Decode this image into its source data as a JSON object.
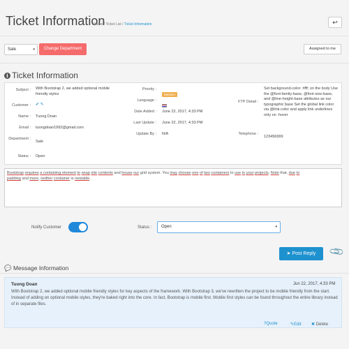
{
  "header": {
    "title": "Ticket Information",
    "breadcrumb": [
      "Home",
      "Ticket List",
      "Ticket Information"
    ],
    "back_icon": "↩"
  },
  "toolbar": {
    "department_value": "Sale",
    "change_department_label": "Change Department",
    "assigned_label": "Assigned to me"
  },
  "ticket": {
    "section_title": "Ticket Information",
    "subject_label": "Subject :",
    "subject_value": "With Bootstrap 2, we added optional mobile friendly styles",
    "customer_label": "Customer :",
    "name_label": "Name :",
    "name_value": "Tuong Doan",
    "email_label": "Email :",
    "email_value": "tuongdoan1992@gmail.com",
    "department_label": "Department :",
    "department_value": "Sale",
    "status_label": "Status :",
    "status_value": "Open",
    "priority_label": "Priority :",
    "priority_value": "Medium",
    "language_label": "Language :",
    "date_added_label": "Date Added :",
    "date_added_value": "June 22, 2017, 4:33 PM",
    "last_update_label": "Last Update :",
    "last_update_value": "June 22, 2017, 4:33 PM",
    "update_by_label": "Update By :",
    "update_by_value": "N/A",
    "ftp_label": "FTP Detail :",
    "ftp_value": "Set background-color: #fff; on the body Use the @font-family-base, @font-size-base, and @line-height-base attributes as our typographic base Set the global link color via @link-color and apply link underlines only on :hover",
    "telephone_label": "Telephone :",
    "telephone_value": "123456999"
  },
  "reply": {
    "text_parts": [
      "Bootstrap",
      " ",
      "requires",
      " ",
      "a containing element",
      " ",
      "to",
      " ",
      "wrap",
      " ",
      "site",
      " ",
      "contents",
      " and ",
      "house",
      " ",
      "our",
      " grid system. You ",
      "may",
      " ",
      "choose",
      " ",
      "one",
      " ",
      "of",
      " ",
      "two",
      " ",
      "containers",
      " to ",
      "use",
      " ",
      "in",
      " ",
      "your",
      " ",
      "projects",
      ". ",
      "Note",
      " that, ",
      "due",
      " ",
      "to",
      "\n",
      "padding",
      " and ",
      "more",
      ", ",
      "neither",
      " ",
      "container",
      " is ",
      "nestable",
      "."
    ],
    "notify_label": "Notify Customer",
    "status_label": "Status :",
    "status_value": "Open",
    "post_label": "Post Reply"
  },
  "messages": {
    "section_title": "Message Information",
    "items": [
      {
        "author": "Tuong Doan",
        "date": "Jun 22, 2017, 4:33 PM",
        "text": "With Bootstrap 2, we added optional mobile friendly styles for key aspects of the framework. With Bootstrap 3, we've rewritten the project to be mobile friendly from the start. Instead of adding on optional mobile styles, they're baked right into the core. In fact, Bootstrap is mobile first. Mobile first styles can be found throughout the entire library instead of in separate files.",
        "quote_label": "Quote",
        "edit_label": "Edit",
        "delete_label": "Delete"
      }
    ]
  },
  "colors": {
    "primary": "#1e91cf",
    "danger": "#f56b6b",
    "warning": "#f0ad4e",
    "message_bg": "#e6f1fb"
  }
}
